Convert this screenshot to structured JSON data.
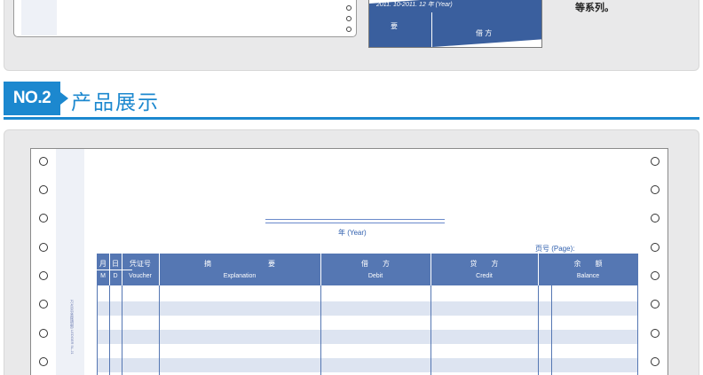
{
  "top": {
    "form_b_caption": "2011. 10-2011. 12 年 (Year)",
    "form_b_head1": "要",
    "form_b_head2": "借 方",
    "note": "等系列。"
  },
  "section": {
    "badge": "NO.2",
    "title": "产品展示"
  },
  "sheet": {
    "year_label": "年 (Year)",
    "page_label": "页号 (Page):",
    "side_text": "万1(总分类账明细) LEDGER 5L-J1",
    "columns": [
      {
        "zh": "月",
        "en": "M"
      },
      {
        "zh": "日",
        "en": "D"
      },
      {
        "zh": "凭证号",
        "en": "Voucher"
      },
      {
        "zh": "摘　　　　　　　　要",
        "en": "Explanation"
      },
      {
        "zh": "借　　方",
        "en": "Debit"
      },
      {
        "zh": "贷　　方",
        "en": "Credit"
      },
      {
        "zh": "余　　额",
        "en": "Balance"
      }
    ]
  },
  "colors": {
    "accent": "#1c88cf",
    "ledger_blue": "#5577b3",
    "row_tint": "#dde4f1"
  }
}
